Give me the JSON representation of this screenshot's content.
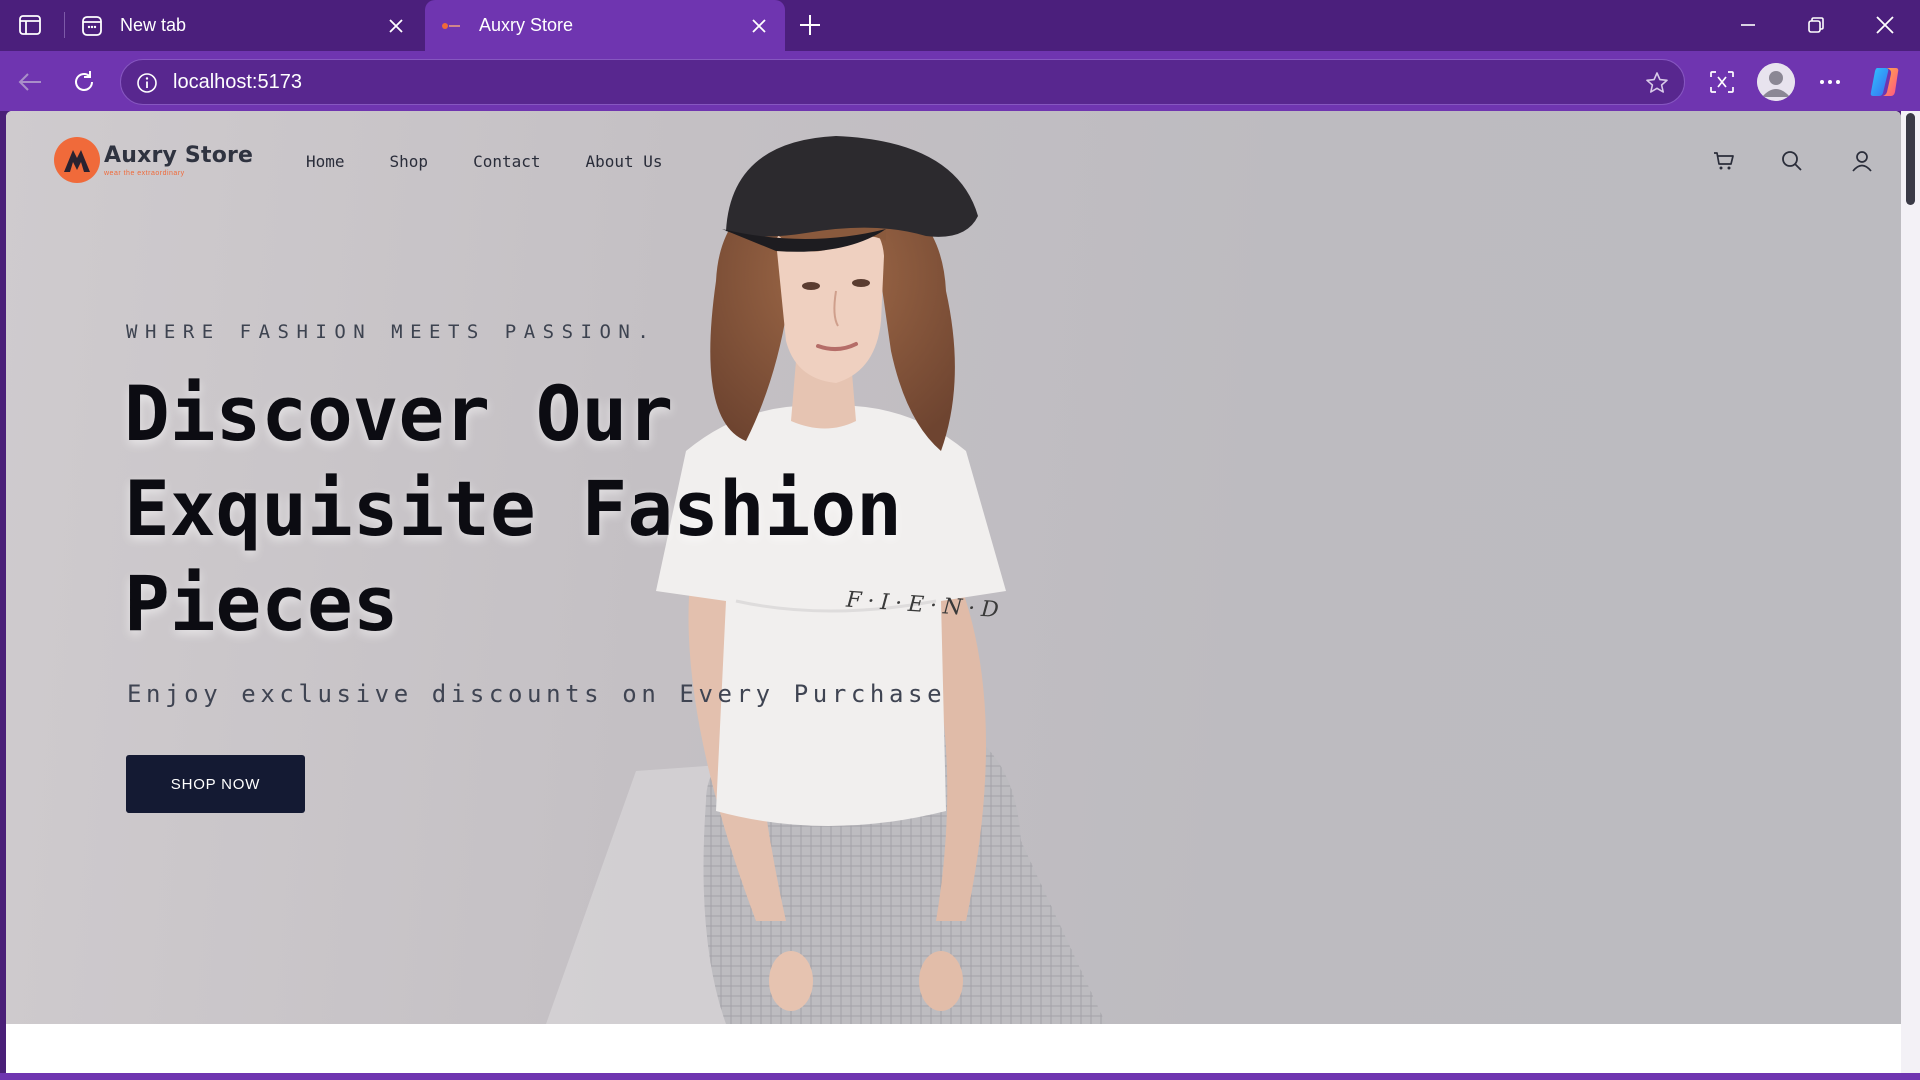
{
  "browser": {
    "tabs": [
      {
        "title": "New tab",
        "active": false
      },
      {
        "title": "Auxry Store",
        "active": true
      }
    ],
    "url": "localhost:5173",
    "icons": [
      "sidebar-toggle-icon",
      "new-tab-page-icon",
      "favicon-icon",
      "close-icon",
      "plus-icon",
      "minimize-icon",
      "restore-icon",
      "back-arrow-icon",
      "reload-icon",
      "info-icon",
      "star-icon",
      "screenshot-icon",
      "profile-icon",
      "more-icon",
      "copilot-icon"
    ]
  },
  "site": {
    "brand": "Auxry Store",
    "tagline": "wear the extraordinary",
    "nav": [
      "Home",
      "Shop",
      "Contact",
      "About Us"
    ],
    "header_icons": [
      "cart-icon",
      "search-icon",
      "user-icon"
    ]
  },
  "hero": {
    "eyebrow": "WHERE FASHION MEETS PASSION.",
    "headline_lines": [
      "Discover Our",
      "Exquisite Fashion",
      "Pieces"
    ],
    "subline": "Enjoy exclusive discounts on Every Purchase",
    "cta": "SHOP NOW",
    "shirt_text": "F·I·E·N·D"
  },
  "colors": {
    "browser_frame": "#4b1f7c",
    "browser_active": "#6f35b0",
    "brand_accent": "#f06a3a",
    "cta_background": "#141a33",
    "hero_background": "#c4c0c4"
  }
}
